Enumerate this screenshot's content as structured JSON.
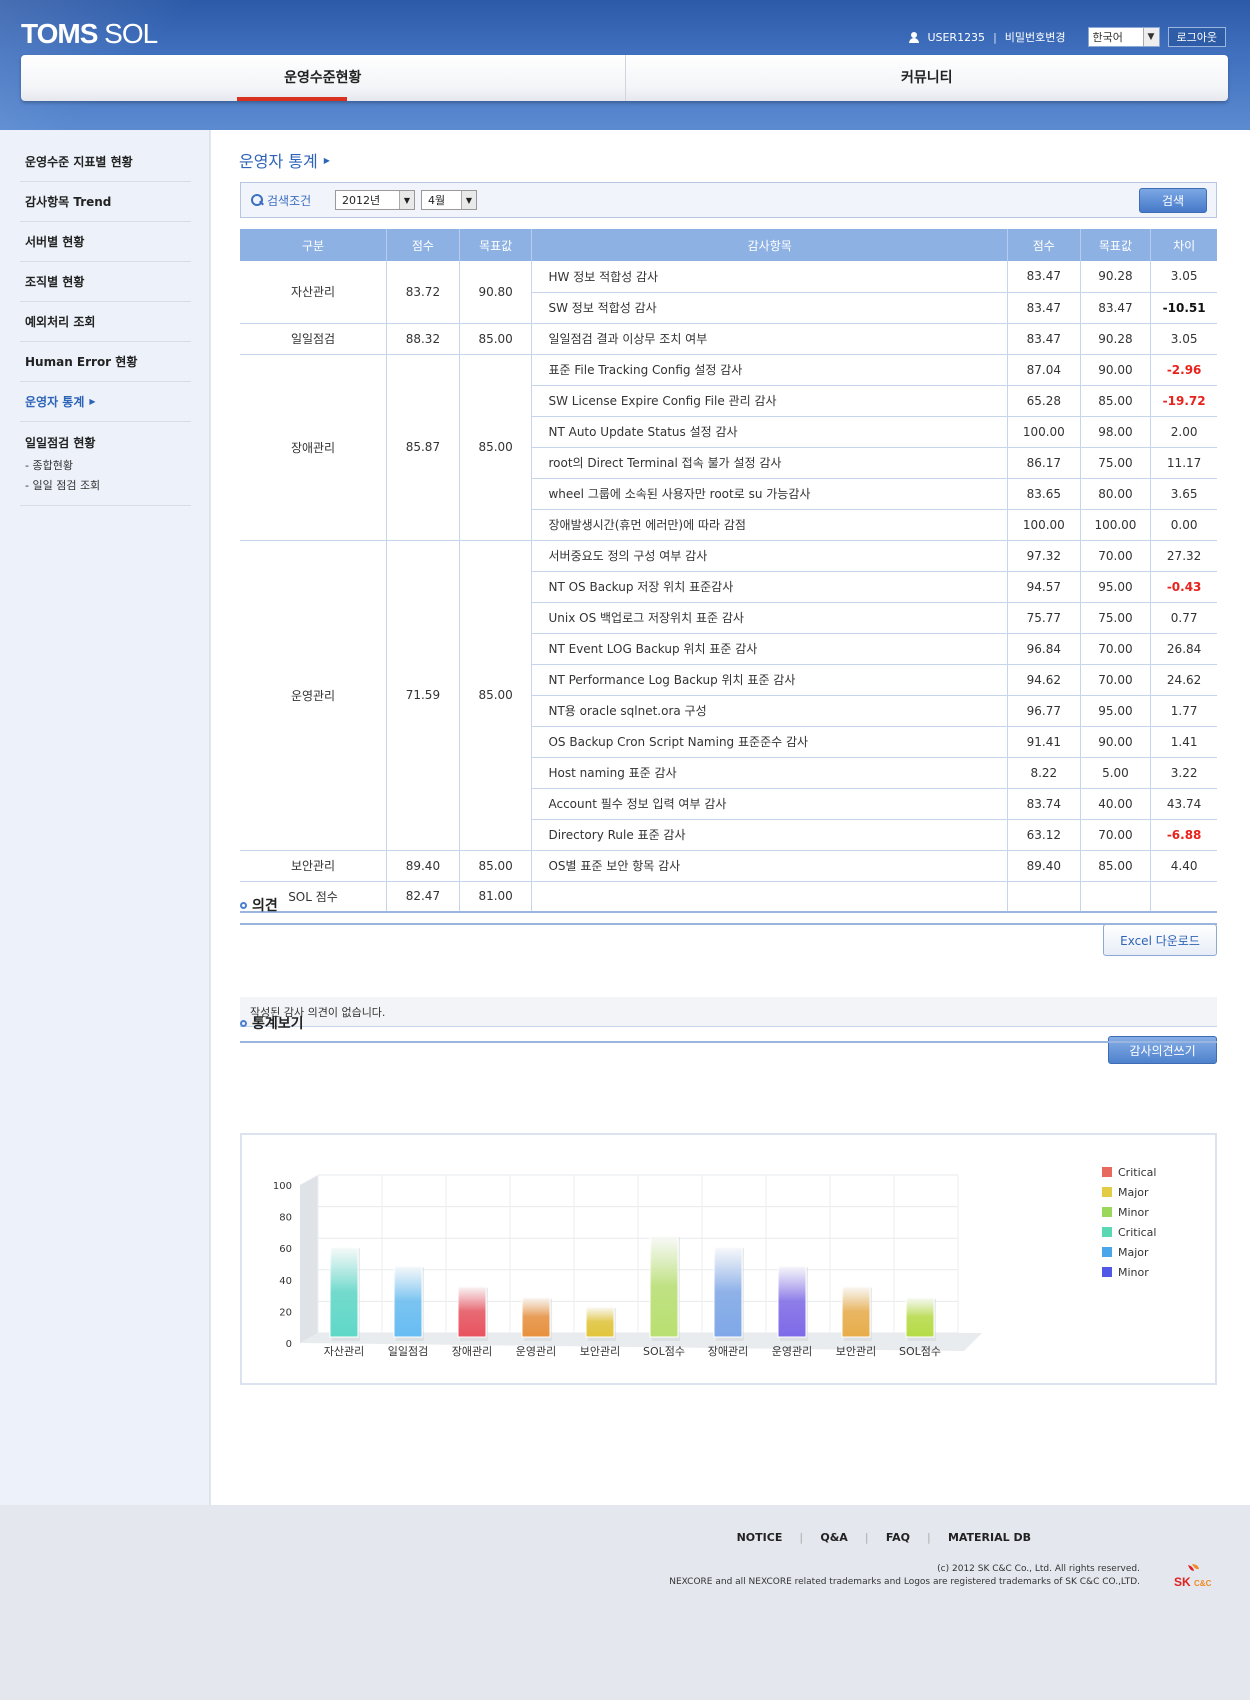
{
  "header": {
    "logo_bold": "TOMS",
    "logo_light": "SOL",
    "user": "USER1235",
    "separator": "|",
    "change_password": "비밀번호변경",
    "language": "한국어",
    "logout": "로그아웃",
    "gnb": [
      {
        "label": "운영수준현황",
        "active": true
      },
      {
        "label": "커뮤니티",
        "active": false
      }
    ]
  },
  "sidebar": {
    "items": [
      {
        "label": "운영수준 지표별 현황"
      },
      {
        "label": "감사항목 Trend"
      },
      {
        "label": "서버별 현황"
      },
      {
        "label": "조직별 현황"
      },
      {
        "label": "예외처리 조회"
      },
      {
        "label": "Human Error 현황"
      },
      {
        "label": "운영자 통계",
        "active": true
      },
      {
        "label": "일일점검 현황",
        "subs": [
          "- 종합현황",
          "- 일일 점검 조회"
        ]
      }
    ]
  },
  "main": {
    "title": "운영자 통계",
    "search": {
      "label": "검색조건",
      "year": "2012년",
      "month": "4월",
      "button": "검색"
    },
    "table": {
      "headers": [
        "구분",
        "점수",
        "목표값",
        "감사항목",
        "점수",
        "목표값",
        "차이"
      ],
      "groups": [
        {
          "category": "자산관리",
          "score": "83.72",
          "target": "90.80",
          "rows": [
            {
              "item": "HW 정보 적합성 감사",
              "score": "83.47",
              "target": "90.28",
              "diff": "3.05",
              "style": ""
            },
            {
              "item": "SW 정보 적합성 감사",
              "score": "83.47",
              "target": "83.47",
              "diff": "-10.51",
              "style": "negbk"
            }
          ]
        },
        {
          "category": "일일점검",
          "score": "88.32",
          "target": "85.00",
          "rows": [
            {
              "item": "일일점검 결과 이상무 조치 여부",
              "score": "83.47",
              "target": "90.28",
              "diff": "3.05",
              "style": ""
            }
          ]
        },
        {
          "category": "장애관리",
          "score": "85.87",
          "target": "85.00",
          "rows": [
            {
              "item": "표준 File Tracking Config 설정 감사",
              "score": "87.04",
              "target": "90.00",
              "diff": "-2.96",
              "style": "neg"
            },
            {
              "item": "SW License Expire Config File 관리 감사",
              "score": "65.28",
              "target": "85.00",
              "diff": "-19.72",
              "style": "neg"
            },
            {
              "item": "NT Auto Update Status 설정 감사",
              "score": "100.00",
              "target": "98.00",
              "diff": "2.00",
              "style": ""
            },
            {
              "item": "root의 Direct Terminal 접속 불가 설정 감사",
              "score": "86.17",
              "target": "75.00",
              "diff": "11.17",
              "style": ""
            },
            {
              "item": "wheel 그룹에 소속된 사용자만 root로 su 가능감사",
              "score": "83.65",
              "target": "80.00",
              "diff": "3.65",
              "style": ""
            },
            {
              "item": "장애발생시간(휴먼 에러만)에 따라 감점",
              "score": "100.00",
              "target": "100.00",
              "diff": "0.00",
              "style": ""
            }
          ]
        },
        {
          "category": "운영관리",
          "score": "71.59",
          "target": "85.00",
          "rows": [
            {
              "item": "서버중요도 정의 구성 여부 감사",
              "score": "97.32",
              "target": "70.00",
              "diff": "27.32",
              "style": ""
            },
            {
              "item": "NT OS Backup 저장 위치 표준감사",
              "score": "94.57",
              "target": "95.00",
              "diff": "-0.43",
              "style": "neg"
            },
            {
              "item": "Unix OS 백업로그 저장위치 표준 감사",
              "score": "75.77",
              "target": "75.00",
              "diff": "0.77",
              "style": ""
            },
            {
              "item": "NT Event LOG Backup 위치 표준 감사",
              "score": "96.84",
              "target": "70.00",
              "diff": "26.84",
              "style": ""
            },
            {
              "item": "NT Performance Log Backup 위치 표준 감사",
              "score": "94.62",
              "target": "70.00",
              "diff": "24.62",
              "style": ""
            },
            {
              "item": "NT용 oracle sqlnet.ora 구성",
              "score": "96.77",
              "target": "95.00",
              "diff": "1.77",
              "style": ""
            },
            {
              "item": "OS Backup Cron Script Naming 표준준수 감사",
              "score": "91.41",
              "target": "90.00",
              "diff": "1.41",
              "style": ""
            },
            {
              "item": "Host naming 표준 감사",
              "score": "8.22",
              "target": "5.00",
              "diff": "3.22",
              "style": ""
            },
            {
              "item": "Account 필수 정보 입력 여부 감사",
              "score": "83.74",
              "target": "40.00",
              "diff": "43.74",
              "style": ""
            },
            {
              "item": "Directory Rule 표준 감사",
              "score": "63.12",
              "target": "70.00",
              "diff": "-6.88",
              "style": "neg"
            }
          ]
        },
        {
          "category": "보안관리",
          "score": "89.40",
          "target": "85.00",
          "rows": [
            {
              "item": "OS별 표준 보안 항목 감사",
              "score": "89.40",
              "target": "85.00",
              "diff": "4.40",
              "style": ""
            }
          ]
        },
        {
          "category": "SOL 점수",
          "score": "82.47",
          "target": "81.00",
          "rows": [
            {
              "item": "",
              "score": "",
              "target": "",
              "diff": "",
              "style": ""
            }
          ]
        }
      ]
    },
    "excel_button": "Excel 다운로드",
    "opinion": {
      "title": "의견",
      "text": "작성된 감사 의견이 없습니다.",
      "button": "감사의견쓰기"
    },
    "stats": {
      "title": "통계보기"
    }
  },
  "chart_data": {
    "type": "bar",
    "categories": [
      "자산관리",
      "일일점검",
      "장애관리",
      "운영관리",
      "보안관리",
      "SOL점수",
      "장애관리",
      "운영관리",
      "보안관리",
      "SOL점수"
    ],
    "values": [
      60,
      48,
      35,
      28,
      22,
      67,
      60,
      48,
      35,
      28
    ],
    "bar_colors": [
      "#5fd8c8",
      "#67bdf2",
      "#e8535f",
      "#e8903d",
      "#e2c53a",
      "#b9e071",
      "#7fa8e8",
      "#7e6ae8",
      "#e8ad4a",
      "#b6dc45"
    ],
    "ylim": [
      0,
      100
    ],
    "yticks": [
      0,
      20,
      40,
      60,
      80,
      100
    ],
    "grid": true,
    "legend_position": "right",
    "legend": [
      {
        "name": "Critical",
        "color": "#e8695e"
      },
      {
        "name": "Major",
        "color": "#e2cb45"
      },
      {
        "name": "Minor",
        "color": "#9bd75a"
      },
      {
        "name": "Critical",
        "color": "#5ad8b4"
      },
      {
        "name": "Major",
        "color": "#4aa6e8"
      },
      {
        "name": "Minor",
        "color": "#5258e6"
      }
    ]
  },
  "footer": {
    "links": [
      "NOTICE",
      "Q&A",
      "FAQ",
      "MATERIAL DB"
    ],
    "copyright": "(c) 2012 SK C&C Co., Ltd. All rights reserved.",
    "trademark": "NEXCORE and all NEXCORE related trademarks and Logos are registered trademarks of SK C&C CO.,LTD.",
    "brand": "SK",
    "brand_sub": "C&C"
  }
}
